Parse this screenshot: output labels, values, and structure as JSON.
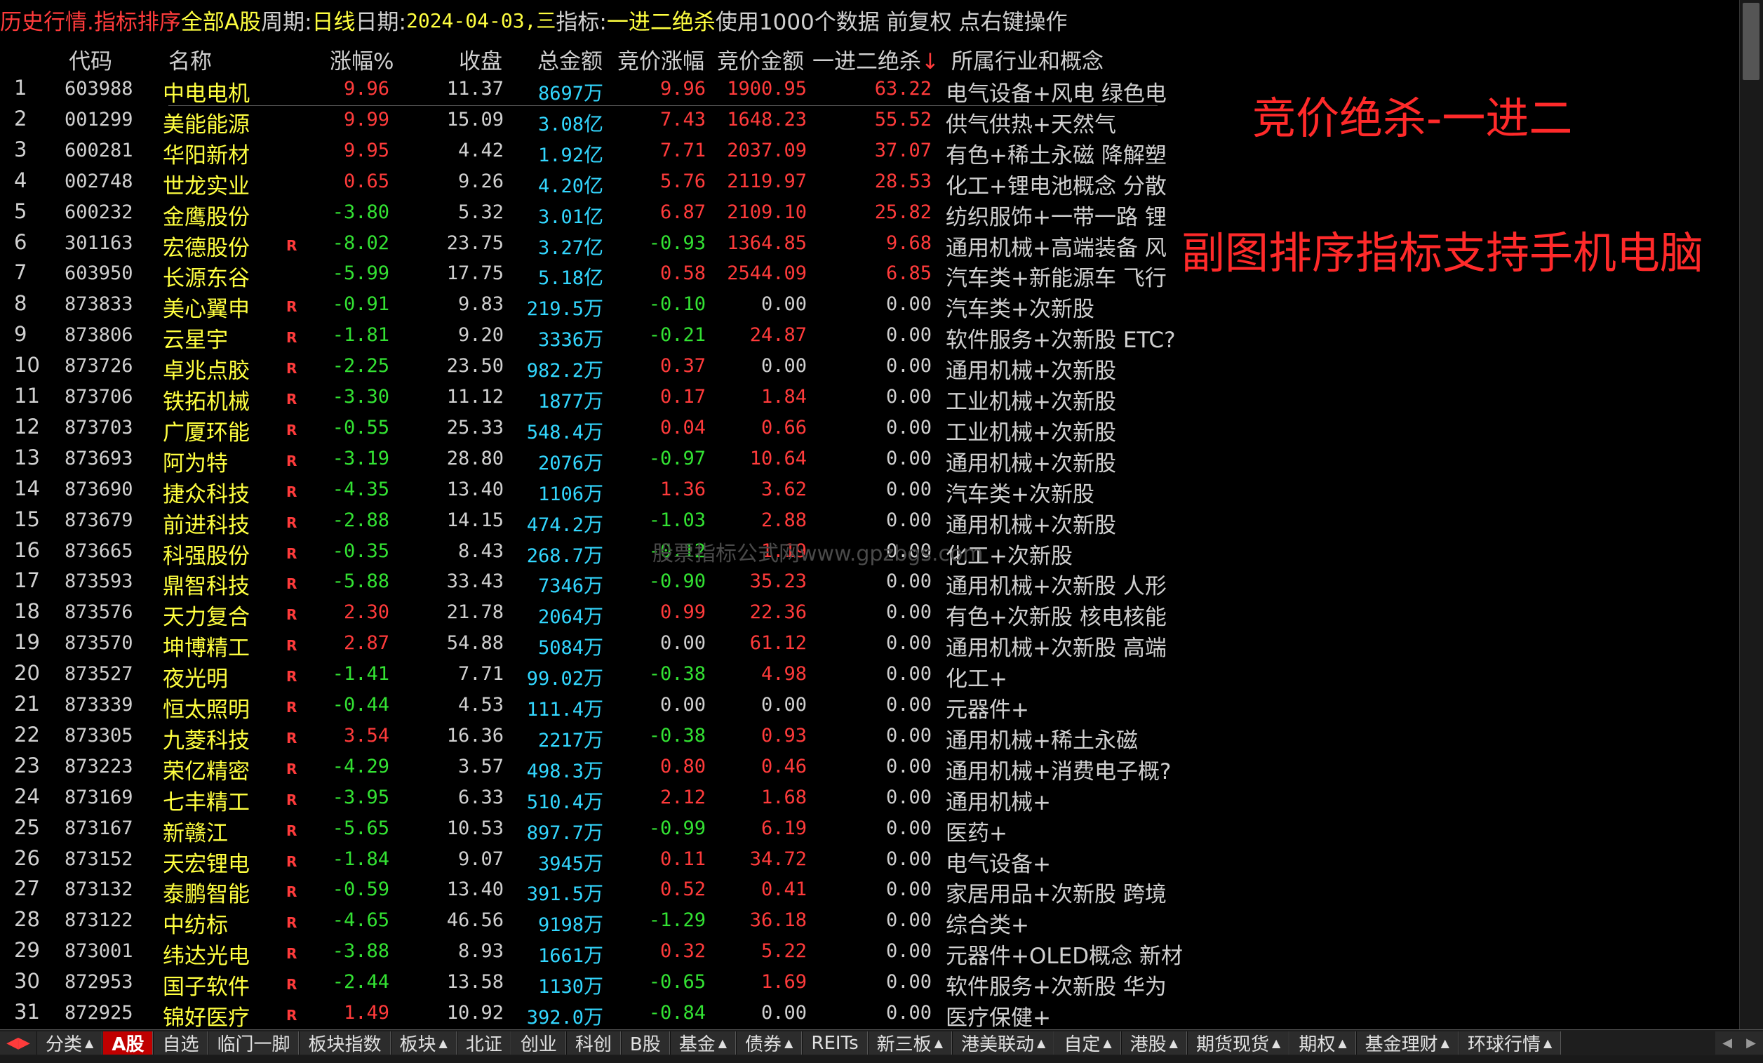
{
  "topbar": {
    "title": "历史行情.指标排序",
    "market": "全部A股",
    "period_label": "周期:",
    "period_value": "日线",
    "date_label": "日期:",
    "date_value": "2024-04-03,三",
    "indicator_label": "指标:",
    "indicator_value": "一进二绝杀",
    "rest": "使用1000个数据 前复权 点右键操作"
  },
  "columns": {
    "code": "代码",
    "name": "名称",
    "chg": "涨幅%",
    "close": "收盘",
    "amount": "总金额",
    "bid_chg": "竞价涨幅",
    "bid_amt": "竞价金额",
    "kill": "一进二绝杀",
    "sort_arrow": "↓",
    "industry": "所属行业和概念"
  },
  "annotations": {
    "line1": "竞价绝杀-一进二",
    "line2": "副图排序指标支持手机电脑",
    "watermark": "股票指标公式网www.gpzbgs.com"
  },
  "rows": [
    {
      "idx": "1",
      "code": "603988",
      "name": "中电电机",
      "r": "",
      "chg": "9.96",
      "close": "11.37",
      "amt": "8697",
      "unit": "万",
      "bchg": "9.96",
      "bamt": "1900.95",
      "kill": "63.22",
      "ind": "电气设备+风电 绿色电"
    },
    {
      "idx": "2",
      "code": "001299",
      "name": "美能能源",
      "r": "",
      "chg": "9.99",
      "close": "15.09",
      "amt": "3.08",
      "unit": "亿",
      "bchg": "7.43",
      "bamt": "1648.23",
      "kill": "55.52",
      "ind": "供气供热+天然气"
    },
    {
      "idx": "3",
      "code": "600281",
      "name": "华阳新材",
      "r": "",
      "chg": "9.95",
      "close": "4.42",
      "amt": "1.92",
      "unit": "亿",
      "bchg": "7.71",
      "bamt": "2037.09",
      "kill": "37.07",
      "ind": "有色+稀土永磁 降解塑"
    },
    {
      "idx": "4",
      "code": "002748",
      "name": "世龙实业",
      "r": "",
      "chg": "0.65",
      "close": "9.26",
      "amt": "4.20",
      "unit": "亿",
      "bchg": "5.76",
      "bamt": "2119.97",
      "kill": "28.53",
      "ind": "化工+锂电池概念 分散"
    },
    {
      "idx": "5",
      "code": "600232",
      "name": "金鹰股份",
      "r": "",
      "chg": "-3.80",
      "close": "5.32",
      "amt": "3.01",
      "unit": "亿",
      "bchg": "6.87",
      "bamt": "2109.10",
      "kill": "25.82",
      "ind": "纺织服饰+一带一路 锂"
    },
    {
      "idx": "6",
      "code": "301163",
      "name": "宏德股份",
      "r": "R",
      "chg": "-8.02",
      "close": "23.75",
      "amt": "3.27",
      "unit": "亿",
      "bchg": "-0.93",
      "bamt": "1364.85",
      "kill": "9.68",
      "ind": "通用机械+高端装备 风"
    },
    {
      "idx": "7",
      "code": "603950",
      "name": "长源东谷",
      "r": "",
      "chg": "-5.99",
      "close": "17.75",
      "amt": "5.18",
      "unit": "亿",
      "bchg": "0.58",
      "bamt": "2544.09",
      "kill": "6.85",
      "ind": "汽车类+新能源车 飞行"
    },
    {
      "idx": "8",
      "code": "873833",
      "name": "美心翼申",
      "r": "R",
      "chg": "-0.91",
      "close": "9.83",
      "amt": "219.5",
      "unit": "万",
      "bchg": "-0.10",
      "bamt": "0.00",
      "kill": "0.00",
      "ind": "汽车类+次新股"
    },
    {
      "idx": "9",
      "code": "873806",
      "name": "云星宇",
      "r": "R",
      "chg": "-1.81",
      "close": "9.20",
      "amt": "3336",
      "unit": "万",
      "bchg": "-0.21",
      "bamt": "24.87",
      "kill": "0.00",
      "ind": "软件服务+次新股 ETC?"
    },
    {
      "idx": "10",
      "code": "873726",
      "name": "卓兆点胶",
      "r": "R",
      "chg": "-2.25",
      "close": "23.50",
      "amt": "982.2",
      "unit": "万",
      "bchg": "0.37",
      "bamt": "0.00",
      "kill": "0.00",
      "ind": "通用机械+次新股"
    },
    {
      "idx": "11",
      "code": "873706",
      "name": "铁拓机械",
      "r": "R",
      "chg": "-3.30",
      "close": "11.12",
      "amt": "1877",
      "unit": "万",
      "bchg": "0.17",
      "bamt": "1.84",
      "kill": "0.00",
      "ind": "工业机械+次新股"
    },
    {
      "idx": "12",
      "code": "873703",
      "name": "广厦环能",
      "r": "R",
      "chg": "-0.55",
      "close": "25.33",
      "amt": "548.4",
      "unit": "万",
      "bchg": "0.04",
      "bamt": "0.66",
      "kill": "0.00",
      "ind": "工业机械+次新股"
    },
    {
      "idx": "13",
      "code": "873693",
      "name": "阿为特",
      "r": "R",
      "chg": "-3.19",
      "close": "28.80",
      "amt": "2076",
      "unit": "万",
      "bchg": "-0.97",
      "bamt": "10.64",
      "kill": "0.00",
      "ind": "通用机械+次新股"
    },
    {
      "idx": "14",
      "code": "873690",
      "name": "捷众科技",
      "r": "R",
      "chg": "-4.35",
      "close": "13.40",
      "amt": "1106",
      "unit": "万",
      "bchg": "1.36",
      "bamt": "3.62",
      "kill": "0.00",
      "ind": "汽车类+次新股"
    },
    {
      "idx": "15",
      "code": "873679",
      "name": "前进科技",
      "r": "R",
      "chg": "-2.88",
      "close": "14.15",
      "amt": "474.2",
      "unit": "万",
      "bchg": "-1.03",
      "bamt": "2.88",
      "kill": "0.00",
      "ind": "通用机械+次新股"
    },
    {
      "idx": "16",
      "code": "873665",
      "name": "科强股份",
      "r": "R",
      "chg": "-0.35",
      "close": "8.43",
      "amt": "268.7",
      "unit": "万",
      "bchg": "-0.12",
      "bamt": "1.19",
      "kill": "0.00",
      "ind": "化工+次新股"
    },
    {
      "idx": "17",
      "code": "873593",
      "name": "鼎智科技",
      "r": "R",
      "chg": "-5.88",
      "close": "33.43",
      "amt": "7346",
      "unit": "万",
      "bchg": "-0.90",
      "bamt": "35.23",
      "kill": "0.00",
      "ind": "通用机械+次新股 人形"
    },
    {
      "idx": "18",
      "code": "873576",
      "name": "天力复合",
      "r": "R",
      "chg": "2.30",
      "close": "21.78",
      "amt": "2064",
      "unit": "万",
      "bchg": "0.99",
      "bamt": "22.36",
      "kill": "0.00",
      "ind": "有色+次新股 核电核能"
    },
    {
      "idx": "19",
      "code": "873570",
      "name": "坤博精工",
      "r": "R",
      "chg": "2.87",
      "close": "54.88",
      "amt": "5084",
      "unit": "万",
      "bchg": "0.00",
      "bamt": "61.12",
      "kill": "0.00",
      "ind": "通用机械+次新股 高端"
    },
    {
      "idx": "20",
      "code": "873527",
      "name": "夜光明",
      "r": "R",
      "chg": "-1.41",
      "close": "7.71",
      "amt": "99.02",
      "unit": "万",
      "bchg": "-0.38",
      "bamt": "4.98",
      "kill": "0.00",
      "ind": "化工+"
    },
    {
      "idx": "21",
      "code": "873339",
      "name": "恒太照明",
      "r": "R",
      "chg": "-0.44",
      "close": "4.53",
      "amt": "111.4",
      "unit": "万",
      "bchg": "0.00",
      "bamt": "0.00",
      "kill": "0.00",
      "ind": "元器件+"
    },
    {
      "idx": "22",
      "code": "873305",
      "name": "九菱科技",
      "r": "R",
      "chg": "3.54",
      "close": "16.36",
      "amt": "2217",
      "unit": "万",
      "bchg": "-0.38",
      "bamt": "0.93",
      "kill": "0.00",
      "ind": "通用机械+稀土永磁"
    },
    {
      "idx": "23",
      "code": "873223",
      "name": "荣亿精密",
      "r": "R",
      "chg": "-4.29",
      "close": "3.57",
      "amt": "498.3",
      "unit": "万",
      "bchg": "0.80",
      "bamt": "0.46",
      "kill": "0.00",
      "ind": "通用机械+消费电子概?"
    },
    {
      "idx": "24",
      "code": "873169",
      "name": "七丰精工",
      "r": "R",
      "chg": "-3.95",
      "close": "6.33",
      "amt": "510.4",
      "unit": "万",
      "bchg": "2.12",
      "bamt": "1.68",
      "kill": "0.00",
      "ind": "通用机械+"
    },
    {
      "idx": "25",
      "code": "873167",
      "name": "新赣江",
      "r": "R",
      "chg": "-5.65",
      "close": "10.53",
      "amt": "897.7",
      "unit": "万",
      "bchg": "-0.99",
      "bamt": "6.19",
      "kill": "0.00",
      "ind": "医药+"
    },
    {
      "idx": "26",
      "code": "873152",
      "name": "天宏锂电",
      "r": "R",
      "chg": "-1.84",
      "close": "9.07",
      "amt": "3945",
      "unit": "万",
      "bchg": "0.11",
      "bamt": "34.72",
      "kill": "0.00",
      "ind": "电气设备+"
    },
    {
      "idx": "27",
      "code": "873132",
      "name": "泰鹏智能",
      "r": "R",
      "chg": "-0.59",
      "close": "13.40",
      "amt": "391.5",
      "unit": "万",
      "bchg": "0.52",
      "bamt": "0.41",
      "kill": "0.00",
      "ind": "家居用品+次新股 跨境"
    },
    {
      "idx": "28",
      "code": "873122",
      "name": "中纺标",
      "r": "R",
      "chg": "-4.65",
      "close": "46.56",
      "amt": "9198",
      "unit": "万",
      "bchg": "-1.29",
      "bamt": "36.18",
      "kill": "0.00",
      "ind": "综合类+"
    },
    {
      "idx": "29",
      "code": "873001",
      "name": "纬达光电",
      "r": "R",
      "chg": "-3.88",
      "close": "8.93",
      "amt": "1661",
      "unit": "万",
      "bchg": "0.32",
      "bamt": "5.22",
      "kill": "0.00",
      "ind": "元器件+OLED概念 新材"
    },
    {
      "idx": "30",
      "code": "872953",
      "name": "国子软件",
      "r": "R",
      "chg": "-2.44",
      "close": "13.58",
      "amt": "1130",
      "unit": "万",
      "bchg": "-0.65",
      "bamt": "1.69",
      "kill": "0.00",
      "ind": "软件服务+次新股 华为"
    },
    {
      "idx": "31",
      "code": "872925",
      "name": "锦好医疗",
      "r": "R",
      "chg": "1.49",
      "close": "10.92",
      "amt": "392.0",
      "unit": "万",
      "bchg": "-0.84",
      "bamt": "0.00",
      "kill": "0.00",
      "ind": "医疗保健+"
    }
  ],
  "bottom_tabs": [
    {
      "label": "分类",
      "arrow": "▲",
      "active": false
    },
    {
      "label": "A股",
      "arrow": "",
      "active": true
    },
    {
      "label": "自选",
      "arrow": "",
      "active": false
    },
    {
      "label": "临门一脚",
      "arrow": "",
      "active": false
    },
    {
      "label": "板块指数",
      "arrow": "",
      "active": false
    },
    {
      "label": "板块",
      "arrow": "▲",
      "active": false
    },
    {
      "label": "北证",
      "arrow": "",
      "active": false
    },
    {
      "label": "创业",
      "arrow": "",
      "active": false
    },
    {
      "label": "科创",
      "arrow": "",
      "active": false
    },
    {
      "label": "B股",
      "arrow": "",
      "active": false
    },
    {
      "label": "基金",
      "arrow": "▲",
      "active": false
    },
    {
      "label": "债券",
      "arrow": "▲",
      "active": false
    },
    {
      "label": "REITs",
      "arrow": "",
      "active": false
    },
    {
      "label": "新三板",
      "arrow": "▲",
      "active": false
    },
    {
      "label": "港美联动",
      "arrow": "▲",
      "active": false
    },
    {
      "label": "自定",
      "arrow": "▲",
      "active": false
    },
    {
      "label": "港股",
      "arrow": "▲",
      "active": false
    },
    {
      "label": "期货现货",
      "arrow": "▲",
      "active": false
    },
    {
      "label": "期权",
      "arrow": "▲",
      "active": false
    },
    {
      "label": "基金理财",
      "arrow": "▲",
      "active": false
    },
    {
      "label": "环球行情",
      "arrow": "▲",
      "active": false
    }
  ],
  "colors": {
    "up": "#ff3b3b",
    "down": "#33e233",
    "amount": "#33d7ff",
    "name": "#ffff40",
    "annotation": "#ff2a2a"
  }
}
